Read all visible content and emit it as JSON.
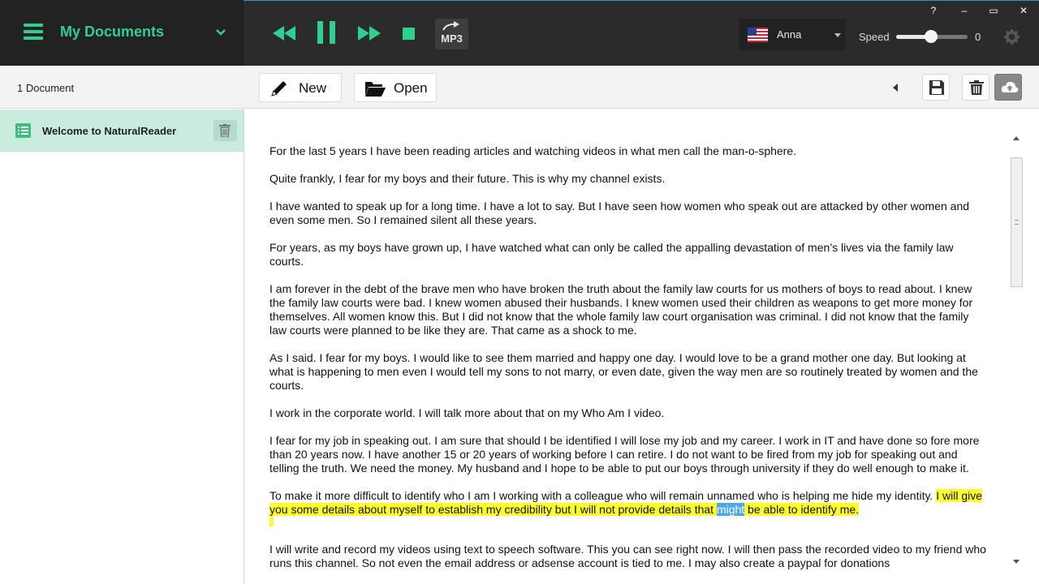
{
  "header": {
    "docs_title": "My Documents",
    "mp3_label": "MP3",
    "voice": {
      "name": "Anna",
      "flag": "us-flag"
    },
    "speed": {
      "label": "Speed",
      "value": "0",
      "level": 0.49
    },
    "window_controls": [
      "?",
      "–",
      "▭",
      "✕"
    ]
  },
  "toolbar": {
    "doc_count": "1 Document",
    "new_label": "New",
    "open_label": "Open"
  },
  "sidebar": {
    "items": [
      {
        "label": "Welcome to NaturalReader"
      }
    ]
  },
  "document": {
    "paragraphs": [
      "For the last 5 years I have been reading articles and watching videos in what men call the man-o-sphere.",
      "Quite frankly, I fear for my boys and their future. This is why my channel exists.",
      "I have wanted to speak up for a long time. I have a lot to say. But I have seen how women who speak out are attacked by other women and even some men. So I remained silent all these years.",
      "For years, as my boys have grown up, I have watched what can only be called the appalling devastation of men’s lives via the family law courts.",
      "I am forever in the debt of the brave men who have broken the truth about the family law courts for us mothers of boys to read about. I knew the family law courts were bad. I knew women abused their husbands. I knew women used their children as weapons to get more money for themselves. All women know this. But I did not know that the whole family law court organisation was criminal. I did not know that the family law courts were planned to be like they are. That came as a shock to me.",
      "As I said. I fear for my boys. I would like to see them married and happy one day. I would love to be a grand mother one day. But looking at what is happening to men even I would tell my sons to not marry, or even date, given the way men are so routinely treated by women and the courts.",
      "I work in the corporate world.  I will talk more about that on my Who Am I video.",
      "I fear for my job in speaking out. I am sure that should I be identified I will lose my job and my career. I work in IT and have done so fore more than 20 years now. I have another 15 or 20 years of working before I can retire. I do not want to be fired from my job for speaking out and telling the truth. We need the money. My husband and I hope to be able to put our boys through university if they do well enough to make it."
    ],
    "highlight_paragraph": {
      "before": "To make it more difficult to identify who I am I working with a colleague who will remain unnamed who is helping me hide my identity. ",
      "highlight_start": "I will give you some details about myself to establish my credibility but I will not provide details that ",
      "current_word": "might",
      "highlight_end": " be able to identify me. "
    },
    "last_paragraph": "I will write and record my videos using text to speech software. This you can see right now. I will then pass the recorded video to my friend who runs this channel. So not even the email address or adsense account is tied to me. I may also create a paypal for donations"
  },
  "colors": {
    "accent": "#2fcf8f",
    "highlight": "#fdfd2a",
    "current_word": "#4ea7e8",
    "sidebar_selected": "#c9ecde"
  }
}
